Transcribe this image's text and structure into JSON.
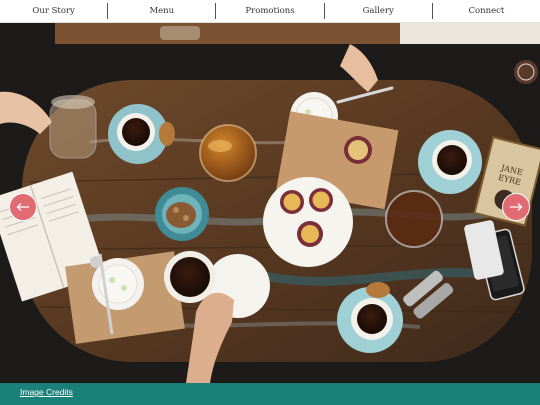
{
  "nav": {
    "items": [
      {
        "label": "Our Story"
      },
      {
        "label": "Menu"
      },
      {
        "label": "Promotions"
      },
      {
        "label": "Gallery"
      },
      {
        "label": "Connect"
      }
    ]
  },
  "hero": {
    "image": "overhead-cafe-table-photo",
    "book_title_line1": "JANE",
    "book_title_line2": "EYRE"
  },
  "slider": {
    "prev_icon": "arrow-left-icon",
    "next_icon": "arrow-right-icon",
    "arrow_color": "#e06b73"
  },
  "footer": {
    "credits_label": "Image Credits",
    "color": "#1b7f7a"
  }
}
